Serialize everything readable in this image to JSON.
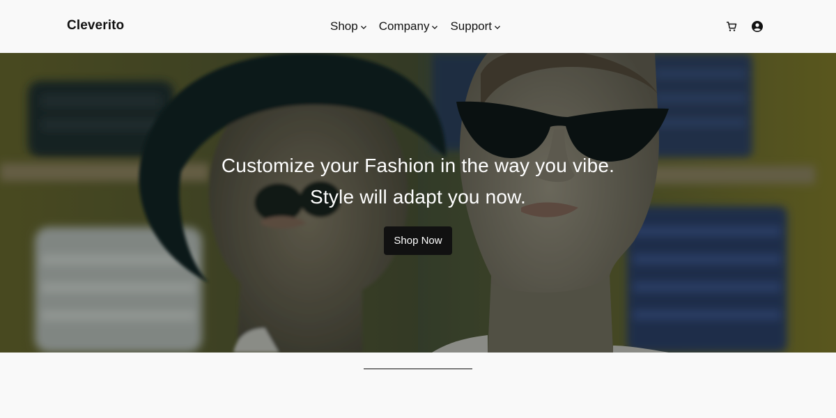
{
  "header": {
    "brand": "Cleverito",
    "nav": [
      {
        "label": "Shop",
        "icon": "chevron-down-icon"
      },
      {
        "label": "Company",
        "icon": "chevron-down-icon"
      },
      {
        "label": "Support",
        "icon": "chevron-down-icon"
      }
    ],
    "icons": [
      "cart-icon",
      "user-account-icon"
    ]
  },
  "hero": {
    "line1": "Customize your Fashion in the way you vibe.",
    "line2": "Style will adapt you now.",
    "button_label": "Shop Now"
  },
  "colors": {
    "page_bg": "#f9f9f9",
    "text": "#111111",
    "button_bg": "#111111",
    "button_text": "#ffffff"
  }
}
